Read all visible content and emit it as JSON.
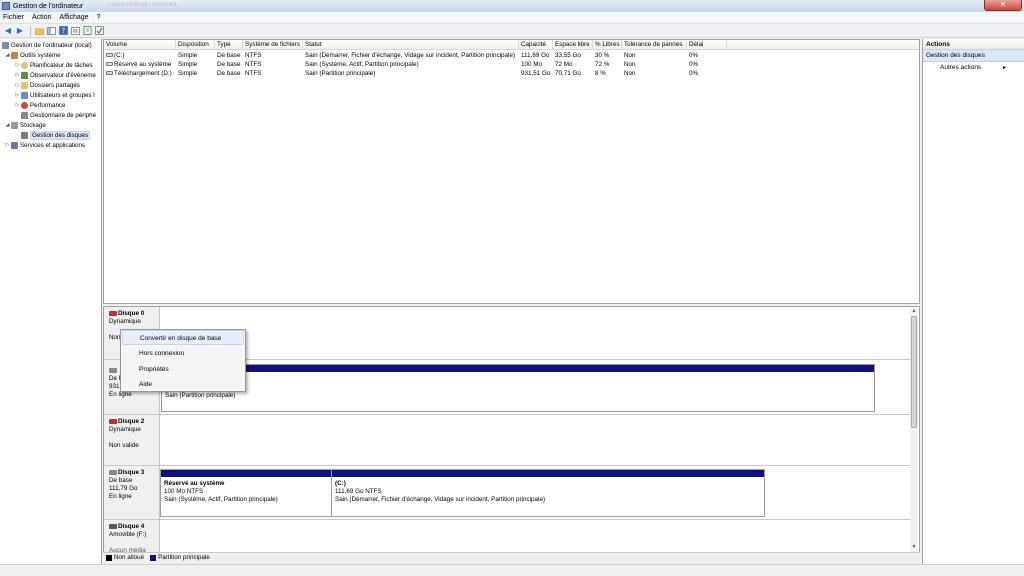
{
  "window": {
    "title": "Gestion de l'ordinateur",
    "ghost_tab": "Forum Hotmail - Consulta...",
    "close": "✕"
  },
  "menu": {
    "items": [
      "Fichier",
      "Action",
      "Affichage",
      "?"
    ]
  },
  "tree": {
    "root": "Gestion de l'ordinateur (local)",
    "outils": "Outils système",
    "planificateur": "Planificateur de tâches",
    "observateur": "Observateur d'événeme",
    "dossiers": "Dossiers partagés",
    "utilisateurs": "Utilisateurs et groupes l",
    "performance": "Performance",
    "gestionnaire": "Gestionnaire de périphé",
    "stockage": "Stockage",
    "gestion_disques": "Gestion des disques",
    "services": "Services et applications"
  },
  "volumes": {
    "headers": [
      "Volume",
      "Disposition",
      "Type",
      "Système de fichiers",
      "Statut",
      "Capacité",
      "Espace libre",
      "% Libres",
      "Tolérance de pannes",
      "Délai"
    ],
    "rows": [
      [
        "(C:)",
        "Simple",
        "De base",
        "NTFS",
        "Sain (Démarrer, Fichier d'échange, Vidage sur incident, Partition principale)",
        "111,69 Go",
        "33,55 Go",
        "30 %",
        "Non",
        "0%"
      ],
      [
        "Réservé au système",
        "Simple",
        "De base",
        "NTFS",
        "Sain (Système, Actif, Partition principale)",
        "100 Mo",
        "72 Mo",
        "72 %",
        "Non",
        "0%"
      ],
      [
        "Téléchargement (D:)",
        "Simple",
        "De base",
        "NTFS",
        "Sain (Partition principale)",
        "931,51 Go",
        "70,71 Go",
        "8 %",
        "Non",
        "0%"
      ]
    ]
  },
  "disks": {
    "d0": {
      "name": "Disque 0",
      "type": "Dynamique",
      "status": "Non"
    },
    "d1": {
      "type": "De b",
      "size": "931,",
      "state": "En ligne",
      "partition_status": "Sain (Partition principale)"
    },
    "d2": {
      "name": "Disque 2",
      "type": "Dynamique",
      "status": "Non valide"
    },
    "d3": {
      "name": "Disque 3",
      "type": "De base",
      "size": "111,79 Go",
      "state": "En ligne",
      "p1": {
        "name": "Réservé au système",
        "size": "100 Mo NTFS",
        "status": "Sain (Système, Actif, Partition principale)"
      },
      "p2": {
        "name": "(C:)",
        "size": "111,69 Go NTFS",
        "status": "Sain (Démarrer, Fichier d'échange, Vidage sur incident, Partition principale)"
      }
    },
    "d4": {
      "name": "Disque 4",
      "type": "Amovible (F:)",
      "extra": "Aucun média"
    }
  },
  "legend": {
    "unallocated": "Non alloué",
    "primary": "Partition principale",
    "unallocated_color": "#000000",
    "primary_color": "#10127a"
  },
  "actions": {
    "title": "Actions",
    "section": "Gestion des disques",
    "more": "Autres actions",
    "chevron": "▸"
  },
  "context_menu": {
    "items": [
      "Convertir en disque de base",
      "Hors connexion",
      "Propriétés",
      "Aide"
    ]
  }
}
